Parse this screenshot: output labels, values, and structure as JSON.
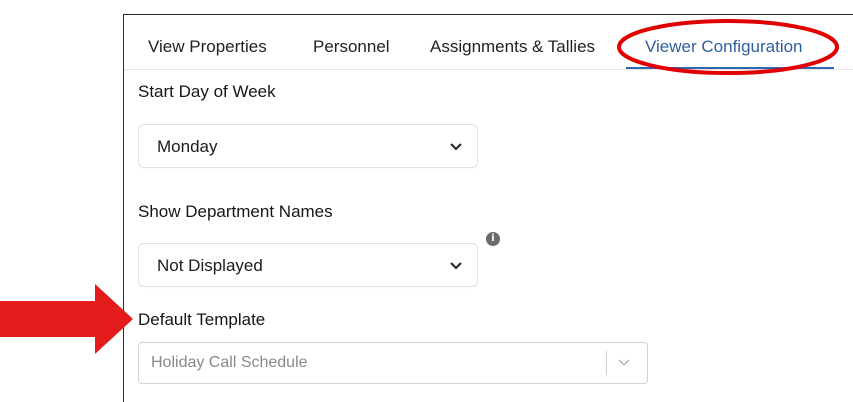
{
  "tabs": [
    {
      "label": "View Properties",
      "active": false
    },
    {
      "label": "Personnel",
      "active": false
    },
    {
      "label": "Assignments & Tallies",
      "active": false
    },
    {
      "label": "Viewer Configuration",
      "active": true
    }
  ],
  "fields": {
    "start_day": {
      "label": "Start Day of Week",
      "value": "Monday"
    },
    "department_names": {
      "label": "Show Department Names",
      "value": "Not Displayed"
    },
    "default_template": {
      "label": "Default Template",
      "value": "Holiday Call Schedule"
    }
  },
  "info_icon": {
    "glyph": "i",
    "icon": "info-icon"
  },
  "colors": {
    "accent": "#2f68b0",
    "highlight": "#e00000",
    "arrow": "#e41b1b"
  }
}
